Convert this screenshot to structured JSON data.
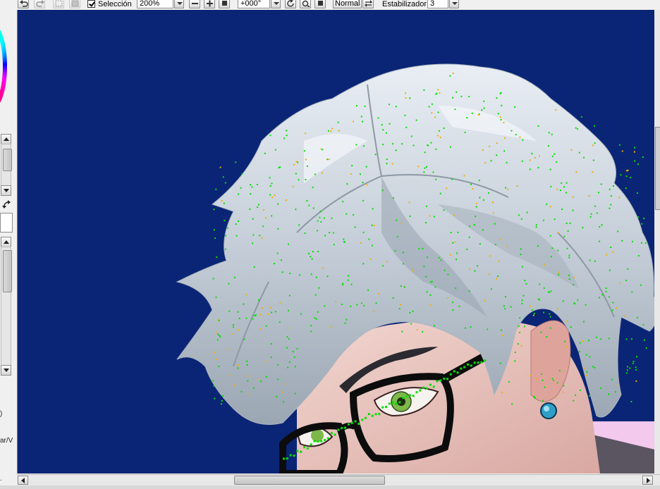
{
  "toolbar": {
    "selection_checked": true,
    "selection_label": "Selección",
    "zoom_value": "200%",
    "rotation_value": "+000°",
    "blend_mode": "Normal",
    "stabilizer_label": "Estabilizador",
    "stabilizer_value": "3"
  },
  "left_panel": {
    "text_1": ")",
    "text_2": "ar/V",
    "text_3": "."
  },
  "canvas": {
    "background_color": "#0a2575",
    "hair_color": "#c9d2dc",
    "selection_marker_colors": [
      "#00e000",
      "#f0b000"
    ]
  },
  "icons": {
    "undo": "undo-icon",
    "redo": "redo-icon",
    "deselect": "deselect-icon",
    "invert": "invert-selection-icon",
    "zoom_out": "zoom-out-icon",
    "zoom_in": "zoom-in-icon",
    "zoom_reset": "zoom-reset-icon",
    "rotate_left": "rotate-left-icon",
    "rotate_reset": "rotate-reset-icon",
    "flip": "flip-horizontal-icon"
  }
}
